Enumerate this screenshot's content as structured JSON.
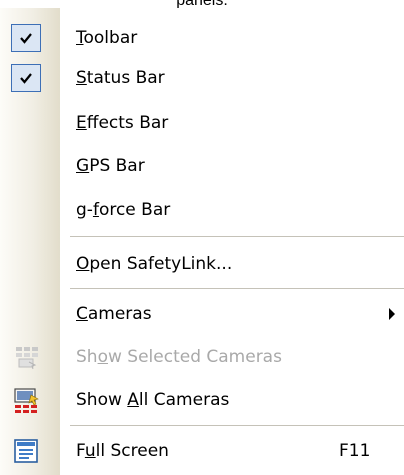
{
  "caption": "panels.",
  "menu": {
    "items": [
      {
        "pre": "",
        "key": "T",
        "post": "oolbar",
        "checked": true
      },
      {
        "pre": "",
        "key": "S",
        "post": "tatus Bar",
        "checked": true
      },
      {
        "pre": "",
        "key": "E",
        "post": "ffects Bar"
      },
      {
        "pre": "",
        "key": "G",
        "post": "PS Bar"
      },
      {
        "pre": "g-",
        "key": "f",
        "post": "orce Bar"
      },
      {
        "pre": "",
        "key": "O",
        "post": "pen SafetyLink..."
      },
      {
        "pre": "",
        "key": "C",
        "post": "ameras",
        "submenu": true
      },
      {
        "pre": "Sh",
        "key": "o",
        "post": "w Selected Cameras",
        "disabled": true,
        "icon": "selected-cameras-icon"
      },
      {
        "pre": "Show ",
        "key": "A",
        "post": "ll Cameras",
        "icon": "all-cameras-icon"
      },
      {
        "pre": "F",
        "key": "u",
        "post": "ll Screen",
        "shortcut": "F11",
        "icon": "full-screen-icon"
      }
    ]
  },
  "colors": {
    "check_highlight": "#dbe6f4",
    "check_border": "#3d6fb6",
    "disabled_text": "#a9a9a9",
    "gutter": "#e2ddcb"
  }
}
